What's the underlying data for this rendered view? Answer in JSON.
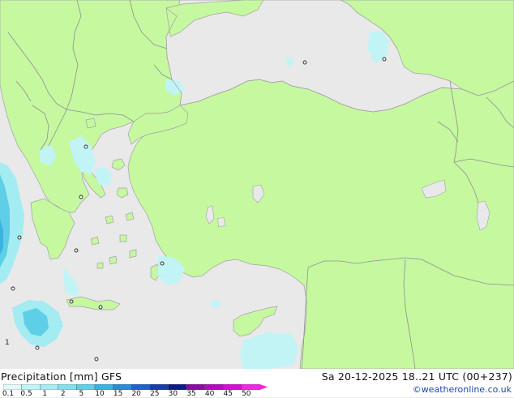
{
  "legend": {
    "title_left": "Precipitation [mm]  GFS",
    "title_right": "Sa 20-12-2025 18..21 UTC (00+237)",
    "credit": "©weatheronline.co.uk",
    "scale_labels": [
      "0.1",
      "0.5",
      "1",
      "2",
      "5",
      "10",
      "15",
      "20",
      "25",
      "30",
      "35",
      "40",
      "45",
      "50"
    ],
    "scale_colors": [
      "#e0fbfb",
      "#c2f4f6",
      "#a3ecf1",
      "#80e1eb",
      "#5ecfe6",
      "#3ab3e0",
      "#2a8bd6",
      "#1f63c8",
      "#173fa8",
      "#0d1c86",
      "#8b0ca4",
      "#b40ac0",
      "#d50ed3",
      "#ef2adf"
    ]
  },
  "map_colors": {
    "land": "#c6f8a0",
    "sea": "#e9e9ea",
    "border": "#8f8f8f",
    "coast": "#a2a2a2"
  },
  "map_labels": {
    "grid_corner": "1"
  }
}
